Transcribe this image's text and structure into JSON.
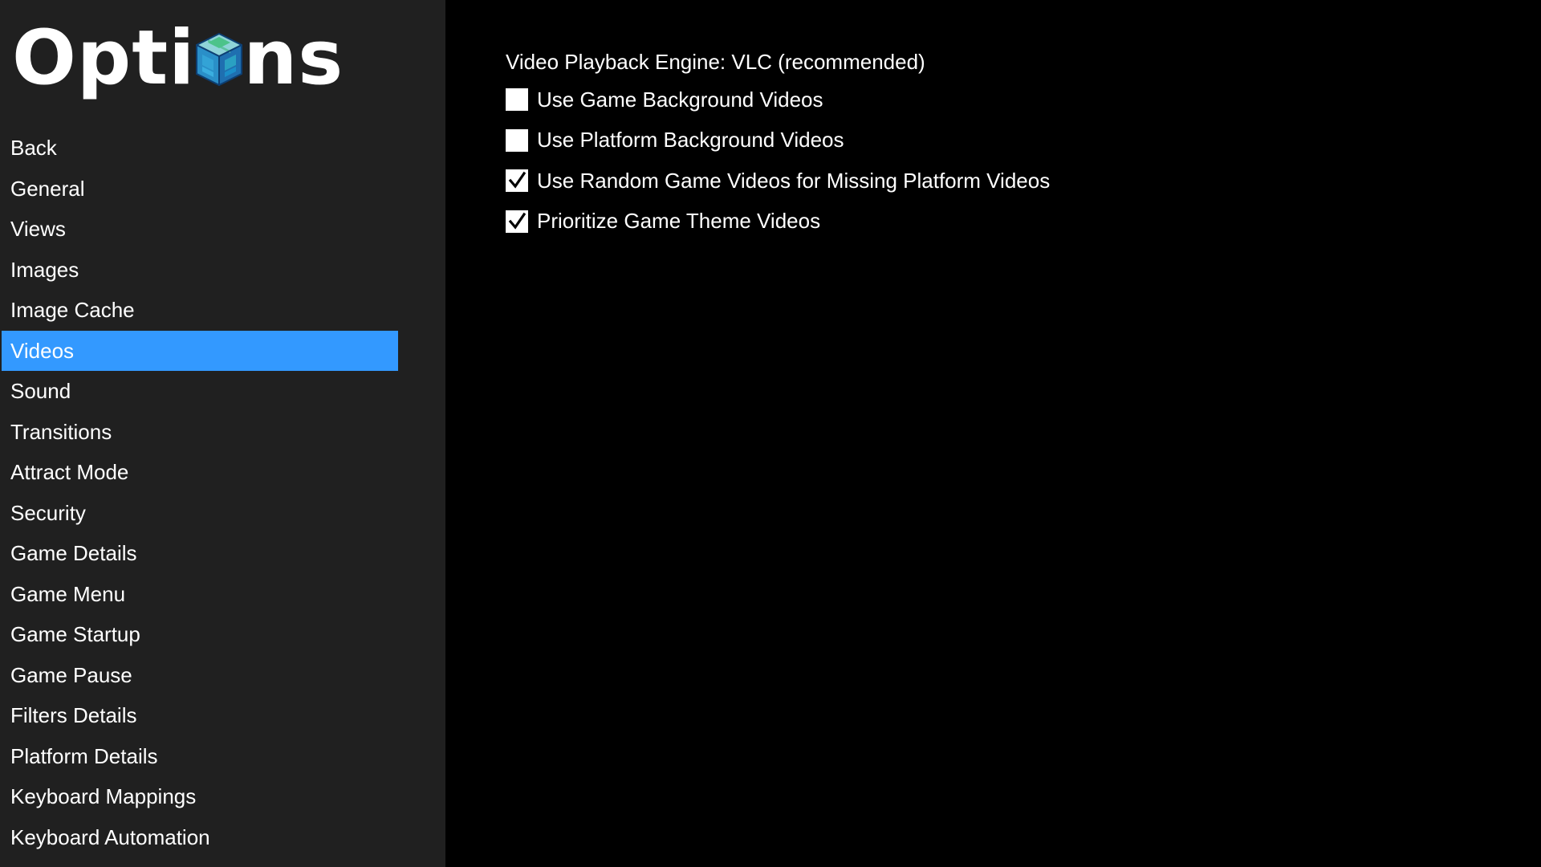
{
  "sidebar": {
    "title_left": "Opti",
    "title_right": "ns",
    "logo_icon": "cube-logo-icon",
    "items": [
      {
        "label": "Back",
        "selected": false
      },
      {
        "label": "General",
        "selected": false
      },
      {
        "label": "Views",
        "selected": false
      },
      {
        "label": "Images",
        "selected": false
      },
      {
        "label": "Image Cache",
        "selected": false
      },
      {
        "label": "Videos",
        "selected": true
      },
      {
        "label": "Sound",
        "selected": false
      },
      {
        "label": "Transitions",
        "selected": false
      },
      {
        "label": "Attract Mode",
        "selected": false
      },
      {
        "label": "Security",
        "selected": false
      },
      {
        "label": "Game Details",
        "selected": false
      },
      {
        "label": "Game Menu",
        "selected": false
      },
      {
        "label": "Game Startup",
        "selected": false
      },
      {
        "label": "Game Pause",
        "selected": false
      },
      {
        "label": "Filters Details",
        "selected": false
      },
      {
        "label": "Platform Details",
        "selected": false
      },
      {
        "label": "Keyboard Mappings",
        "selected": false
      },
      {
        "label": "Keyboard Automation",
        "selected": false
      }
    ]
  },
  "content": {
    "engine_label": "Video Playback Engine: VLC (recommended)",
    "options": [
      {
        "label": "Use Game Background Videos",
        "checked": false
      },
      {
        "label": "Use Platform Background Videos",
        "checked": false
      },
      {
        "label": "Use Random Game Videos for Missing Platform Videos",
        "checked": true
      },
      {
        "label": "Prioritize Game Theme Videos",
        "checked": true
      }
    ]
  },
  "colors": {
    "sidebar_bg": "#202020",
    "main_bg": "#000000",
    "selection": "#3399ff",
    "text": "#ffffff"
  }
}
